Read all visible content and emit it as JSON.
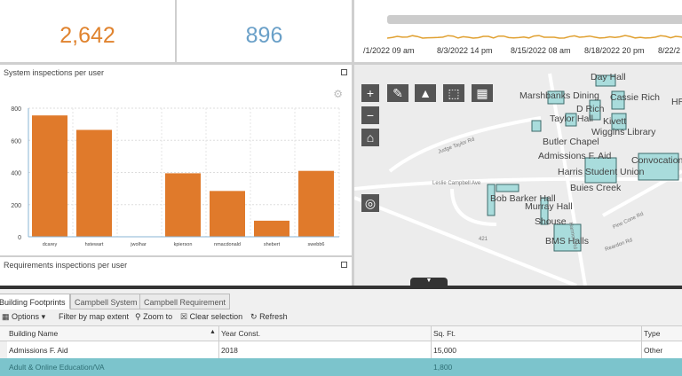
{
  "kpis": [
    {
      "value": "2,642",
      "color": "#e0832e"
    },
    {
      "value": "896",
      "color": "#6aa0c8"
    }
  ],
  "timeline": {
    "labels": [
      "/1/2022 09 am",
      "8/3/2022 14 pm",
      "8/15/2022 08 am",
      "8/18/2022 20 pm",
      "8/22/2"
    ],
    "color": "#e0a030"
  },
  "chart_data": {
    "type": "bar",
    "title": "System inspections per user",
    "categories": [
      "dcarey",
      "hstewart",
      "jwolhar",
      "kpierson",
      "nmacdonald",
      "shebert",
      "swebb6"
    ],
    "values": [
      755,
      665,
      0,
      395,
      285,
      100,
      410
    ],
    "ylim": [
      0,
      800
    ],
    "yticks": [
      0,
      200,
      400,
      600,
      800
    ],
    "grid": true,
    "color": "#e07a2b"
  },
  "panel2": {
    "title": "Requirements inspections per user"
  },
  "map": {
    "labels": [
      "Day Hall",
      "Marshbanks Dining",
      "Cassie Rich",
      "HR",
      "D Rich",
      "Taylor Hall",
      "Kivett",
      "Wiggins Library",
      "Butler Chapel",
      "Admissions F. Aid",
      "Convocation",
      "Harris Student Union",
      "Buies Creek",
      "Bob Barker Hall",
      "Murray Hall",
      "Shouse",
      "BMS Halls"
    ],
    "roads": [
      "Judge Taylor Rd",
      "Leslie Campbell Ave",
      "421",
      "Pine Cone Rd",
      "Reardon Rd",
      "Harmon Rd"
    ]
  },
  "table": {
    "tabs": [
      "Building Footprints",
      "Campbell System",
      "Campbell Requirement"
    ],
    "toolbar": {
      "options": "Options",
      "filter": "Filter by map extent",
      "zoom": "Zoom to",
      "clear": "Clear selection",
      "refresh": "Refresh"
    },
    "columns": [
      "Building Name",
      "Year Const.",
      "Sq. Ft.",
      "Type"
    ],
    "rows": [
      [
        "Admissions F. Aid",
        "2018",
        "15,000",
        "Other"
      ],
      [
        "Adult & Online Education/VA",
        "",
        "1,800",
        ""
      ]
    ]
  }
}
